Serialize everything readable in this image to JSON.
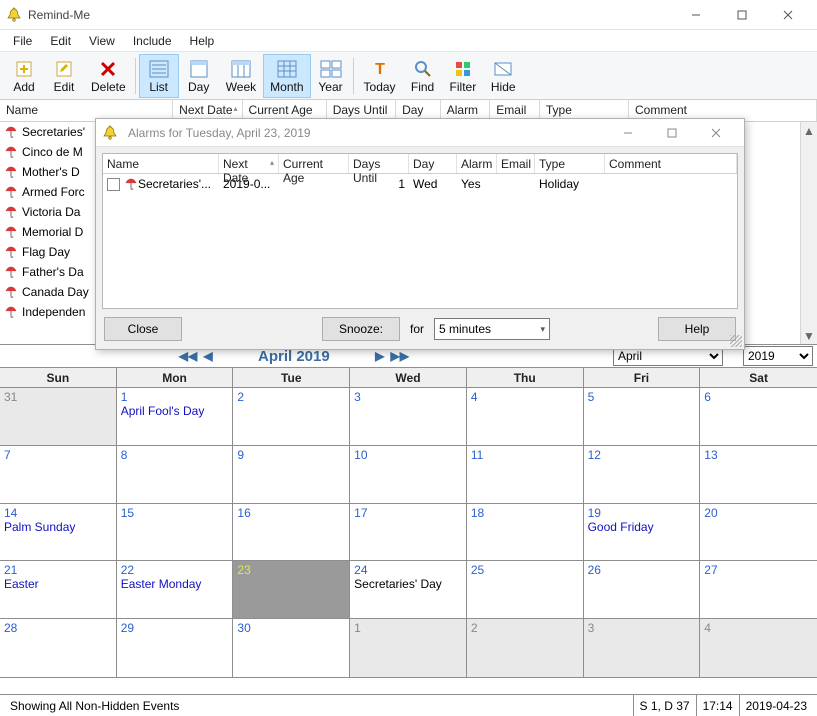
{
  "window": {
    "title": "Remind-Me"
  },
  "menu": [
    "File",
    "Edit",
    "View",
    "Include",
    "Help"
  ],
  "toolbar": [
    {
      "id": "add",
      "label": "Add"
    },
    {
      "id": "edit",
      "label": "Edit"
    },
    {
      "id": "delete",
      "label": "Delete"
    },
    {
      "id": "sep"
    },
    {
      "id": "list",
      "label": "List",
      "active": true
    },
    {
      "id": "day",
      "label": "Day"
    },
    {
      "id": "week",
      "label": "Week"
    },
    {
      "id": "month",
      "label": "Month",
      "active": true
    },
    {
      "id": "year",
      "label": "Year"
    },
    {
      "id": "sep"
    },
    {
      "id": "today",
      "label": "Today"
    },
    {
      "id": "find",
      "label": "Find"
    },
    {
      "id": "filter",
      "label": "Filter"
    },
    {
      "id": "hide",
      "label": "Hide"
    }
  ],
  "columns": [
    "Name",
    "Next Date",
    "Current Age",
    "Days Until",
    "Day",
    "Alarm",
    "Email",
    "Type",
    "Comment"
  ],
  "eventList": [
    "Secretaries'",
    "Cinco de M",
    "Mother's D",
    "Armed Forc",
    "Victoria Da",
    "Memorial D",
    "Flag Day",
    "Father's Da",
    "Canada Day",
    "Independen"
  ],
  "calendar": {
    "title": "April 2019",
    "monthSelect": "April",
    "yearSelect": "2019",
    "dayNames": [
      "Sun",
      "Mon",
      "Tue",
      "Wed",
      "Thu",
      "Fri",
      "Sat"
    ],
    "cells": [
      {
        "n": "31",
        "out": true
      },
      {
        "n": "1",
        "ev": "April Fool's Day"
      },
      {
        "n": "2"
      },
      {
        "n": "3"
      },
      {
        "n": "4"
      },
      {
        "n": "5"
      },
      {
        "n": "6"
      },
      {
        "n": "7"
      },
      {
        "n": "8"
      },
      {
        "n": "9"
      },
      {
        "n": "10"
      },
      {
        "n": "11"
      },
      {
        "n": "12"
      },
      {
        "n": "13"
      },
      {
        "n": "14",
        "ev": "Palm Sunday"
      },
      {
        "n": "15"
      },
      {
        "n": "16"
      },
      {
        "n": "17"
      },
      {
        "n": "18"
      },
      {
        "n": "19",
        "ev": "Good Friday"
      },
      {
        "n": "20"
      },
      {
        "n": "21",
        "ev": "Easter"
      },
      {
        "n": "22",
        "ev": "Easter Monday"
      },
      {
        "n": "23",
        "today": true
      },
      {
        "n": "24",
        "ev": "Secretaries' Day",
        "evBlack": true
      },
      {
        "n": "25"
      },
      {
        "n": "26"
      },
      {
        "n": "27"
      },
      {
        "n": "28"
      },
      {
        "n": "29"
      },
      {
        "n": "30"
      },
      {
        "n": "1",
        "out": true
      },
      {
        "n": "2",
        "out": true
      },
      {
        "n": "3",
        "out": true
      },
      {
        "n": "4",
        "out": true
      }
    ]
  },
  "status": {
    "text": "Showing All Non-Hidden Events",
    "seg1": "S 1, D 37",
    "time": "17:14",
    "date": "2019-04-23"
  },
  "dialog": {
    "title": "Alarms for Tuesday, April 23, 2019",
    "columns": [
      "Name",
      "Next Date",
      "Current Age",
      "Days Until",
      "Day",
      "Alarm",
      "Email",
      "Type",
      "Comment"
    ],
    "row": {
      "name": "Secretaries'...",
      "nextDate": "2019-0...",
      "currentAge": "",
      "daysUntil": "1",
      "day": "Wed",
      "alarm": "Yes",
      "email": "",
      "type": "Holiday",
      "comment": ""
    },
    "closeLabel": "Close",
    "snoozeLabel": "Snooze:",
    "forLabel": "for",
    "snoozeValue": "5 minutes",
    "helpLabel": "Help"
  }
}
